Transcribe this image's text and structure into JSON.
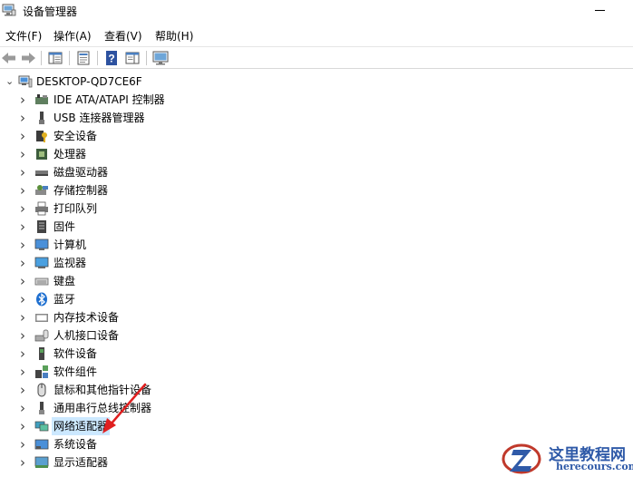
{
  "window": {
    "title": "设备管理器",
    "icon": "device-manager-icon"
  },
  "menu": [
    {
      "label": "文件(F)",
      "name": "menu-file"
    },
    {
      "label": "操作(A)",
      "name": "menu-action"
    },
    {
      "label": "查看(V)",
      "name": "menu-view"
    },
    {
      "label": "帮助(H)",
      "name": "menu-help"
    }
  ],
  "toolbar": [
    {
      "name": "back-button",
      "icon": "back-arrow-icon"
    },
    {
      "name": "forward-button",
      "icon": "forward-arrow-icon"
    },
    {
      "name": "show-hide-console-tree-button",
      "icon": "console-tree-icon"
    },
    {
      "name": "properties-button",
      "icon": "properties-icon"
    },
    {
      "name": "help-button",
      "icon": "help-icon"
    },
    {
      "name": "show-action-pane-button",
      "icon": "action-pane-icon"
    },
    {
      "name": "scan-hardware-button",
      "icon": "monitor-scan-icon"
    }
  ],
  "tree": {
    "root": {
      "label": "DESKTOP-QD7CE6F",
      "icon": "computer-icon",
      "expanded": true
    },
    "categories": [
      {
        "label": "IDE ATA/ATAPI 控制器",
        "icon": "ide-controller-icon"
      },
      {
        "label": "USB 连接器管理器",
        "icon": "usb-connector-icon"
      },
      {
        "label": "安全设备",
        "icon": "security-device-icon"
      },
      {
        "label": "处理器",
        "icon": "processor-icon"
      },
      {
        "label": "磁盘驱动器",
        "icon": "disk-drive-icon"
      },
      {
        "label": "存储控制器",
        "icon": "storage-controller-icon"
      },
      {
        "label": "打印队列",
        "icon": "printer-icon"
      },
      {
        "label": "固件",
        "icon": "firmware-icon"
      },
      {
        "label": "计算机",
        "icon": "computer-icon"
      },
      {
        "label": "监视器",
        "icon": "monitor-icon"
      },
      {
        "label": "键盘",
        "icon": "keyboard-icon"
      },
      {
        "label": "蓝牙",
        "icon": "bluetooth-icon"
      },
      {
        "label": "内存技术设备",
        "icon": "memory-device-icon"
      },
      {
        "label": "人机接口设备",
        "icon": "hid-icon"
      },
      {
        "label": "软件设备",
        "icon": "software-device-icon"
      },
      {
        "label": "软件组件",
        "icon": "software-component-icon"
      },
      {
        "label": "鼠标和其他指针设备",
        "icon": "mouse-icon"
      },
      {
        "label": "通用串行总线控制器",
        "icon": "usb-controller-icon"
      },
      {
        "label": "网络适配器",
        "icon": "network-adapter-icon",
        "selected": true
      },
      {
        "label": "系统设备",
        "icon": "system-device-icon"
      },
      {
        "label": "显示适配器",
        "icon": "display-adapter-icon"
      }
    ]
  },
  "annotation": {
    "icon": "red-arrow-icon",
    "color": "#e02020"
  },
  "watermark": {
    "title": "这里教程网",
    "url": "herecours.com",
    "color": "#2f5aa8"
  },
  "colors": {
    "selection": "#cce8ff",
    "text": "#000000"
  }
}
